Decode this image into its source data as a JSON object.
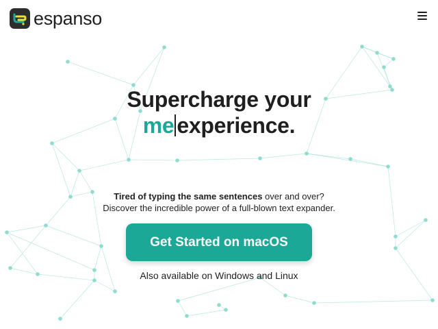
{
  "header": {
    "brand_name": "espanso",
    "logo_icon": "espanso-logo-icon",
    "menu_icon": "hamburger-menu-icon"
  },
  "hero": {
    "title_line1": "Supercharge your",
    "typed_text": "me",
    "title_line2_rest": "experience."
  },
  "subtitle": {
    "bold_part": "Tired of typing the same sentences",
    "rest_line1": " over and over?",
    "line2": "Discover the incredible power of a full-blown text expander."
  },
  "cta": {
    "label": "Get Started on macOS"
  },
  "also_available": "Also available on Windows and Linux",
  "colors": {
    "accent": "#1ca896",
    "text": "#1f1f1f",
    "network_line": "#a7e3d9",
    "network_node": "#8fdccf",
    "background": "#ffffff"
  }
}
